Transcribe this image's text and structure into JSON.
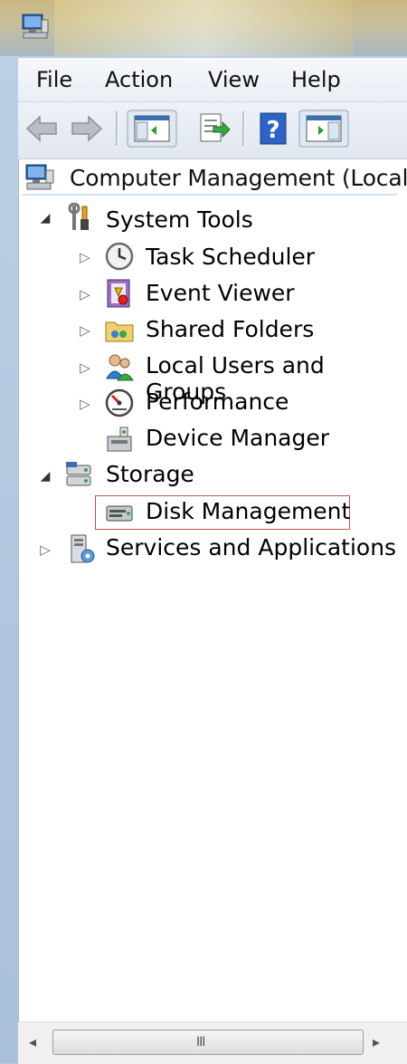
{
  "menu": {
    "file": "File",
    "action": "Action",
    "view": "View",
    "help": "Help"
  },
  "toolbar": {
    "icons": [
      "back-arrow-icon",
      "forward-arrow-icon",
      "show-console-tree-icon",
      "export-list-icon",
      "help-icon",
      "show-action-pane-icon"
    ]
  },
  "tree": {
    "root": "Computer Management (Local",
    "system_tools": "System Tools",
    "task_scheduler": "Task Scheduler",
    "event_viewer": "Event Viewer",
    "shared_folders": "Shared Folders",
    "local_users": "Local Users and Groups",
    "performance": "Performance",
    "device_manager": "Device Manager",
    "storage": "Storage",
    "disk_management": "Disk Management",
    "services_apps": "Services and Applications",
    "selected": "Disk Management"
  },
  "scrollbar": {
    "left_arrow": "◂",
    "right_arrow": "▸",
    "grip": "III"
  },
  "colors": {
    "selection_border": "#c0504d",
    "menu_bg": "#f3f6fa",
    "tree_bg": "#ffffff"
  }
}
